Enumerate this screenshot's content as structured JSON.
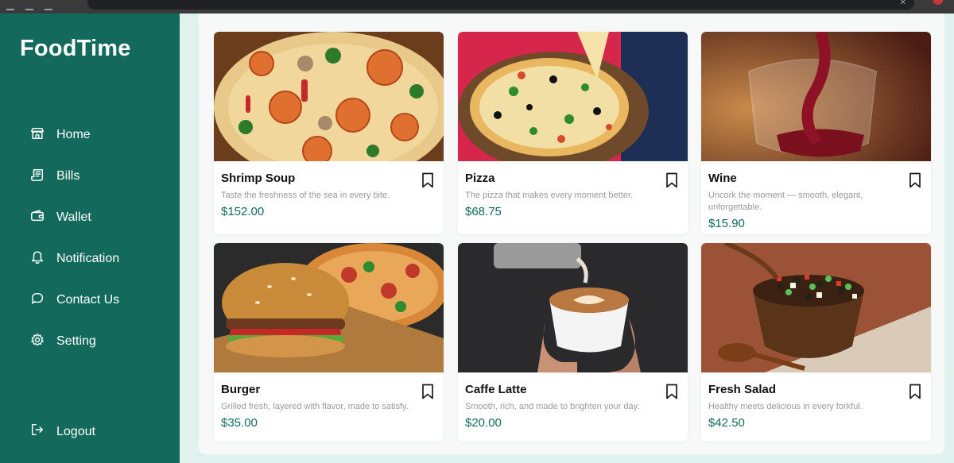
{
  "app": {
    "brand": "FoodTime"
  },
  "sidebar": {
    "items": [
      {
        "label": "Home",
        "icon": "store-icon"
      },
      {
        "label": "Bills",
        "icon": "receipt-icon"
      },
      {
        "label": "Wallet",
        "icon": "wallet-icon"
      },
      {
        "label": "Notification",
        "icon": "bell-icon"
      },
      {
        "label": "Contact Us",
        "icon": "chat-icon"
      },
      {
        "label": "Setting",
        "icon": "gear-icon"
      }
    ],
    "logout": {
      "label": "Logout",
      "icon": "logout-icon"
    }
  },
  "menu": {
    "items": [
      {
        "name": "Shrimp Soup",
        "description": "Taste the freshness of the sea in every bite.",
        "price": "$152.00",
        "image": "shrimp-soup-photo"
      },
      {
        "name": "Pizza",
        "description": "The pizza that makes every moment better.",
        "price": "$68.75",
        "image": "pizza-photo"
      },
      {
        "name": "Wine",
        "description": "Uncork the moment — smooth, elegant, unforgettable.",
        "price": "$15.90",
        "image": "wine-photo"
      },
      {
        "name": "Burger",
        "description": "Grilled fresh, layered with flavor, made to satisfy.",
        "price": "$35.00",
        "image": "burger-photo"
      },
      {
        "name": "Caffe Latte",
        "description": "Smooth, rich, and made to brighten your day.",
        "price": "$20.00",
        "image": "caffe-latte-photo"
      },
      {
        "name": "Fresh Salad",
        "description": "Healthy meets delicious in every forkful.",
        "price": "$42.50",
        "image": "fresh-salad-photo"
      }
    ]
  },
  "colors": {
    "sidebar": "#13695c",
    "price": "#13695c",
    "background": "#dff2ee"
  }
}
